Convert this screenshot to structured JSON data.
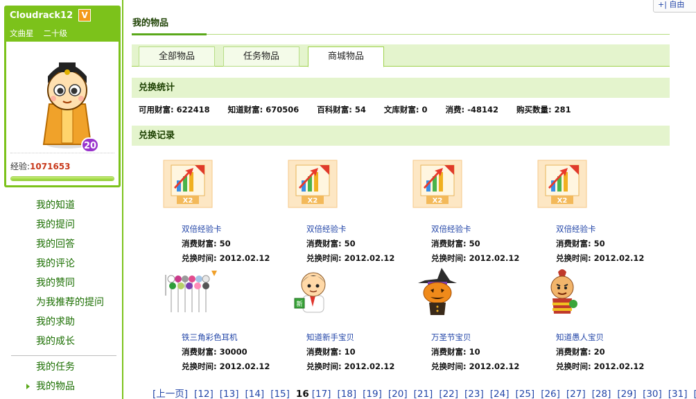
{
  "profile": {
    "username": "Cloudrack12",
    "vip_badge": "V",
    "title": "文曲星",
    "grade": "二十级",
    "level": "20",
    "exp_label": "经验:",
    "exp_value": "1071653"
  },
  "left_nav": {
    "items": [
      "我的知道",
      "我的提问",
      "我的回答",
      "我的评论",
      "我的赞同",
      "为我推荐的提问",
      "我的求助",
      "我的成长"
    ],
    "items2": [
      "我的任务",
      "我的物品"
    ],
    "active": "我的物品"
  },
  "main": {
    "title": "我的物品",
    "tabs": [
      {
        "label": "全部物品"
      },
      {
        "label": "任务物品"
      },
      {
        "label": "商城物品"
      }
    ],
    "active_tab": "商城物品"
  },
  "stats": {
    "heading": "兑换统计",
    "items": [
      {
        "label": "可用财富:",
        "value": "622418"
      },
      {
        "label": "知道财富:",
        "value": "670506"
      },
      {
        "label": "百科财富:",
        "value": "54"
      },
      {
        "label": "文库财富:",
        "value": "0"
      },
      {
        "label": "消费:",
        "value": "-48142"
      },
      {
        "label": "购买数量:",
        "value": "281"
      }
    ]
  },
  "records": {
    "heading": "兑换记录",
    "cost_label": "消费财富:",
    "time_label": "兑换时间:",
    "items": [
      {
        "name": "双倍经验卡",
        "cost": "50",
        "time": "2012.02.12",
        "icon": "double-exp-card-icon"
      },
      {
        "name": "双倍经验卡",
        "cost": "50",
        "time": "2012.02.12",
        "icon": "double-exp-card-icon"
      },
      {
        "name": "双倍经验卡",
        "cost": "50",
        "time": "2012.02.12",
        "icon": "double-exp-card-icon"
      },
      {
        "name": "双倍经验卡",
        "cost": "50",
        "time": "2012.02.12",
        "icon": "double-exp-card-icon"
      },
      {
        "name": "铁三角彩色耳机",
        "cost": "30000",
        "time": "2012.02.12",
        "icon": "earphones-icon"
      },
      {
        "name": "知道新手宝贝",
        "cost": "10",
        "time": "2012.02.12",
        "icon": "newbie-mascot-icon"
      },
      {
        "name": "万圣节宝贝",
        "cost": "10",
        "time": "2012.02.12",
        "icon": "halloween-pumpkin-icon"
      },
      {
        "name": "知道愚人宝贝",
        "cost": "20",
        "time": "2012.02.12",
        "icon": "fool-mascot-icon"
      }
    ]
  },
  "pager": {
    "prev": "[上一页]",
    "pages_before": [
      "[12]",
      "[13]",
      "[14]",
      "[15]"
    ],
    "current": "16",
    "pages_after": [
      "[17]",
      "[18]",
      "[19]",
      "[20]",
      "[21]",
      "[22]",
      "[23]",
      "[24]",
      "[25]",
      "[26]",
      "[27]",
      "[28]",
      "[29]",
      "[30]",
      "[31]"
    ],
    "next": "[下"
  },
  "corner": {
    "label": "+| 自由"
  },
  "colors": {
    "accent": "#7cc21b",
    "link": "#2346a8",
    "nav": "#1a6e00",
    "exp": "#c8391b",
    "level_badge": "#9933cc"
  }
}
